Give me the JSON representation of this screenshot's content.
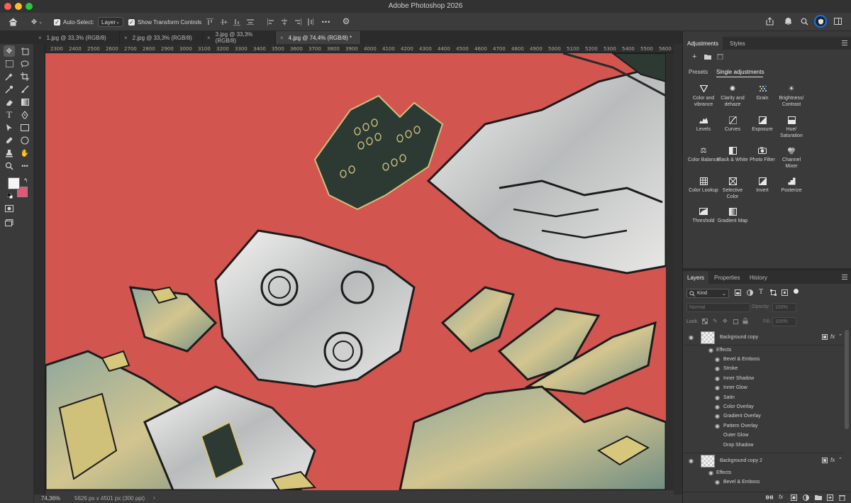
{
  "app": {
    "title": "Adobe Photoshop 2026",
    "traffic_colors": [
      "#ff5f57",
      "#febc2e",
      "#28c840"
    ]
  },
  "options_bar": {
    "auto_select_label": "Auto-Select:",
    "auto_select_checked": true,
    "layer_select": "Layer",
    "transform_label": "Show Transform Controls",
    "transform_checked": true,
    "more_label": "•••"
  },
  "document_tabs": [
    {
      "label": "1.jpg @ 33,3% (RGB/8)",
      "active": false
    },
    {
      "label": "2.jpg @ 33,3% (RGB/8)",
      "active": false
    },
    {
      "label": "3.jpg @ 33,3% (RGB/8)",
      "active": false
    },
    {
      "label": "4.jpg @ 74,4% (RGB/8) *",
      "active": true
    }
  ],
  "ruler_ticks": [
    "2300",
    "2400",
    "2500",
    "2600",
    "2700",
    "2800",
    "2900",
    "3000",
    "3100",
    "3200",
    "3300",
    "3400",
    "3500",
    "3600",
    "3700",
    "3800",
    "3900",
    "4000",
    "4100",
    "4200",
    "4300",
    "4400",
    "4500",
    "4600",
    "4700",
    "4800",
    "4900",
    "5000",
    "5100",
    "5200",
    "5300",
    "5400",
    "5500",
    "5600"
  ],
  "colors": {
    "canvas_bg": "#d25550",
    "foreground_swatch": "#f5f5f5",
    "background_swatch": "#e0577a",
    "accent": "#1473e6"
  },
  "status": {
    "zoom": "74,36%",
    "doc_size": "5626 px x 4501 px (300 ppi)",
    "arrow": "›"
  },
  "adjustments_panel": {
    "tabs": [
      "Adjustments",
      "Styles"
    ],
    "subtabs": [
      "Presets",
      "Single adjustments"
    ],
    "active_subtab": "Single adjustments",
    "items": [
      {
        "label": "Color and vibrance",
        "icon": "triangle-down-icon"
      },
      {
        "label": "Clarity and dehaze",
        "icon": "sparkle-icon"
      },
      {
        "label": "Grain",
        "icon": "grain-icon"
      },
      {
        "label": "Brightness/ Contrast",
        "icon": "sun-icon"
      },
      {
        "label": "Levels",
        "icon": "histogram-icon"
      },
      {
        "label": "Curves",
        "icon": "curves-icon"
      },
      {
        "label": "Exposure",
        "icon": "exposure-icon"
      },
      {
        "label": "Hue/ Saturation",
        "icon": "hue-icon"
      },
      {
        "label": "Color Balance",
        "icon": "balance-icon"
      },
      {
        "label": "Black & White",
        "icon": "bw-icon"
      },
      {
        "label": "Photo Filter",
        "icon": "camera-icon"
      },
      {
        "label": "Channel Mixer",
        "icon": "channel-icon"
      },
      {
        "label": "Color Lookup",
        "icon": "grid-icon"
      },
      {
        "label": "Selective Color",
        "icon": "selective-icon"
      },
      {
        "label": "Invert",
        "icon": "invert-icon"
      },
      {
        "label": "Posterize",
        "icon": "posterize-icon"
      },
      {
        "label": "Threshold",
        "icon": "threshold-icon"
      },
      {
        "label": "Gradient Map",
        "icon": "gradient-icon"
      }
    ]
  },
  "layers_panel": {
    "tabs": [
      "Layers",
      "Properties",
      "History"
    ],
    "filter_kind": "Kind",
    "blend_mode": "Normal",
    "opacity_label": "Opacity:",
    "opacity_value": "100%",
    "lock_label": "Lock:",
    "fill_label": "Fill:",
    "fill_value": "100%",
    "layers": [
      {
        "name": "Background copy",
        "effects_label": "Effects",
        "effects": [
          {
            "name": "Bevel & Emboss",
            "visible": true
          },
          {
            "name": "Stroke",
            "visible": true
          },
          {
            "name": "Inner Shadow",
            "visible": true
          },
          {
            "name": "Inner Glow",
            "visible": true
          },
          {
            "name": "Satin",
            "visible": true
          },
          {
            "name": "Color Overlay",
            "visible": true
          },
          {
            "name": "Gradient Overlay",
            "visible": true
          },
          {
            "name": "Pattern Overlay",
            "visible": true
          },
          {
            "name": "Outer Glow",
            "visible": false
          },
          {
            "name": "Drop Shadow",
            "visible": false
          }
        ]
      },
      {
        "name": "Background copy 2",
        "effects_label": "Effects",
        "effects": [
          {
            "name": "Bevel & Emboss",
            "visible": true
          }
        ]
      }
    ]
  }
}
